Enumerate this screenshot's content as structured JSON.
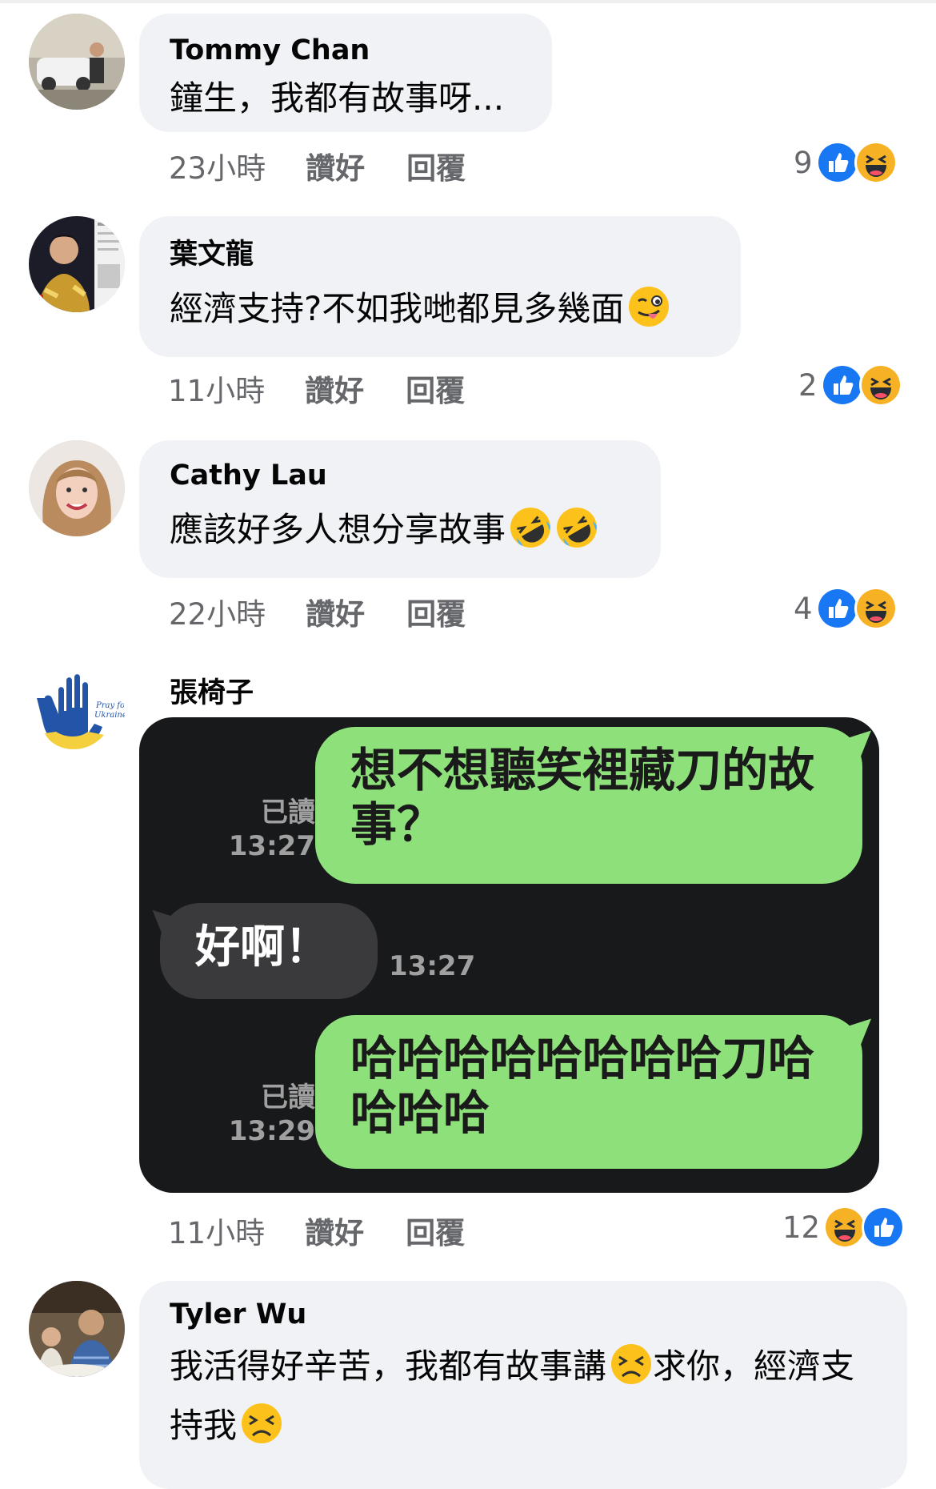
{
  "comments": [
    {
      "author": "Tommy Chan",
      "text": "鐘生，我都有故事呀...",
      "time": "23小時",
      "like_label": "讚好",
      "reply_label": "回覆",
      "reaction_count": "9",
      "reactions": [
        "like-icon",
        "haha-icon"
      ]
    },
    {
      "author": "葉文龍",
      "text": "經濟支持?不如我哋都見多幾面",
      "emoji": "winking-tongue-emoji",
      "time": "11小時",
      "like_label": "讚好",
      "reply_label": "回覆",
      "reaction_count": "2",
      "reactions": [
        "like-icon",
        "haha-icon"
      ]
    },
    {
      "author": "Cathy Lau",
      "text": "應該好多人想分享故事",
      "emoji": "rofl-emoji",
      "time": "22小時",
      "like_label": "讚好",
      "reply_label": "回覆",
      "reaction_count": "4",
      "reactions": [
        "like-icon",
        "haha-icon"
      ]
    },
    {
      "author": "張椅子",
      "time": "11小時",
      "like_label": "讚好",
      "reply_label": "回覆",
      "reaction_count": "12",
      "reactions": [
        "haha-icon",
        "like-icon"
      ],
      "image": {
        "messages": [
          {
            "side": "right",
            "text": "想不想聽笑裡藏刀的故事？",
            "read": "已讀",
            "time": "13:27"
          },
          {
            "side": "left",
            "text": "好啊！",
            "time": "13:27"
          },
          {
            "side": "right",
            "text": "哈哈哈哈哈哈哈哈刀哈哈哈哈",
            "read": "已讀",
            "time": "13:29"
          }
        ]
      }
    },
    {
      "author": "Tyler Wu",
      "text_part1": "我活得好辛苦，我都有故事講",
      "text_part2": "求你，經濟支持我",
      "emoji": "persevering-face-emoji"
    }
  ],
  "colors": {
    "bubble_bg": "#f0f2f5",
    "secondary_text": "#65676b",
    "like_blue": "#1877f2",
    "chat_green": "#8de07a",
    "chat_bg": "#18191b"
  }
}
